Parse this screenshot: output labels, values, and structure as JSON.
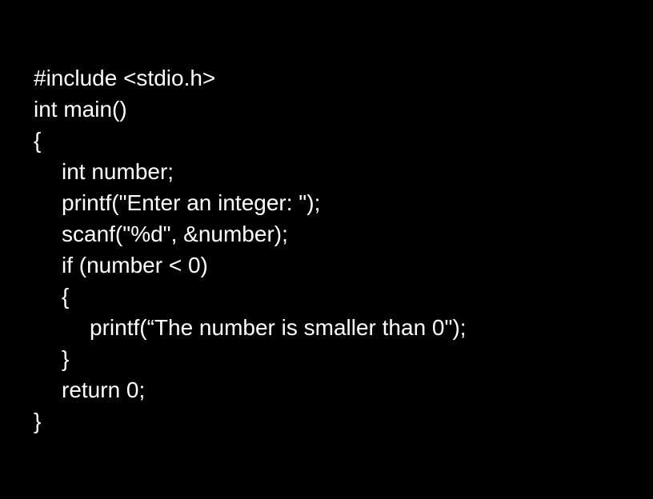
{
  "colors": {
    "background": "#000000",
    "text": "#ffffff"
  },
  "code": {
    "lines": [
      {
        "text": "#include <stdio.h>",
        "indent": 0
      },
      {
        "text": "int main()",
        "indent": 0
      },
      {
        "text": "{",
        "indent": 0
      },
      {
        "text": "int number;",
        "indent": 1
      },
      {
        "text": "printf(\"Enter an integer: \");",
        "indent": 1
      },
      {
        "text": "scanf(\"%d\", &number);",
        "indent": 1
      },
      {
        "text": "if (number < 0)",
        "indent": 1
      },
      {
        "text": "{",
        "indent": 1
      },
      {
        "text": "printf(“The number is smaller than 0\");",
        "indent": 2
      },
      {
        "text": "}",
        "indent": 1
      },
      {
        "text": "return 0;",
        "indent": 1
      },
      {
        "text": "}",
        "indent": 0
      }
    ]
  }
}
